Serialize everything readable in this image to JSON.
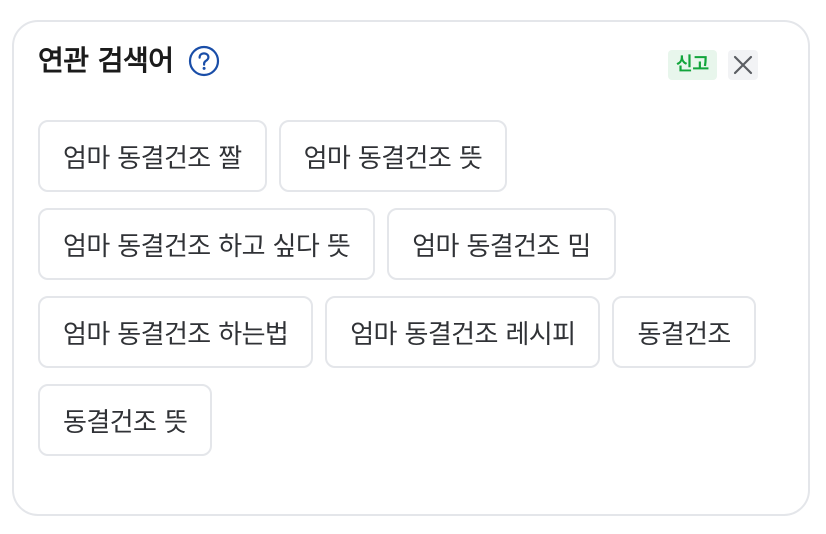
{
  "panel": {
    "title": "연관 검색어",
    "help_icon": "question-circle-icon",
    "report_label": "신고",
    "close_icon": "close-icon",
    "accent_color": "#12a53b",
    "help_icon_color": "#1a4ea8"
  },
  "related_searches": [
    "엄마 동결건조 짤",
    "엄마 동결건조 뜻",
    "엄마 동결건조 하고 싶다 뜻",
    "엄마 동결건조 밈",
    "엄마 동결건조 하는법",
    "엄마 동결건조 레시피",
    "동결건조",
    "동결건조 뜻"
  ]
}
